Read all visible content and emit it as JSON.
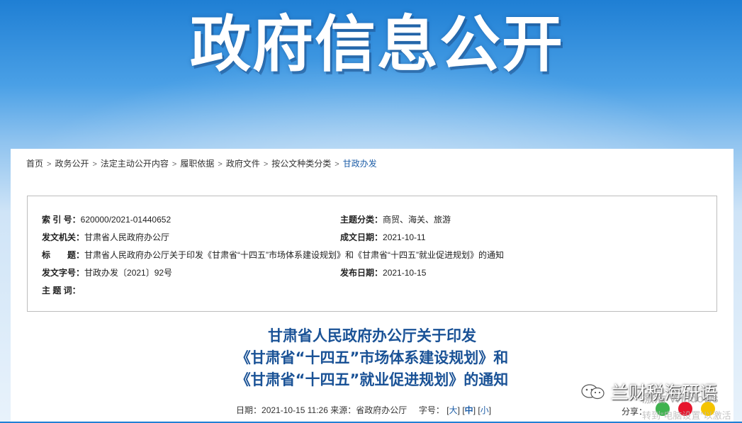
{
  "banner": {
    "title": "政府信息公开"
  },
  "breadcrumb": {
    "items": [
      "首页",
      "政务公开",
      "法定主动公开内容",
      "履职依据",
      "政府文件",
      "按公文种类分类"
    ],
    "current": "甘政办发",
    "sep": ">"
  },
  "meta": {
    "index_label": "索 引 号：",
    "index_value": "620000/2021-01440652",
    "category_label": "主题分类：",
    "category_value": "商贸、海关、旅游",
    "issuer_label": "发文机关：",
    "issuer_value": "甘肃省人民政府办公厅",
    "created_label": "成文日期：",
    "created_value": "2021-10-11",
    "title_label": "标　　题：",
    "title_value": "甘肃省人民政府办公厅关于印发《甘肃省“十四五”市场体系建设规划》和《甘肃省“十四五”就业促进规划》的通知",
    "docno_label": "发文字号：",
    "docno_value": "甘政办发〔2021〕92号",
    "published_label": "发布日期：",
    "published_value": "2021-10-15",
    "keywords_label": "主 题 词：",
    "keywords_value": ""
  },
  "doc": {
    "title_line1": "甘肃省人民政府办公厅关于印发",
    "title_line2": "《甘肃省“十四五”市场体系建设规划》和",
    "title_line3": "《甘肃省“十四五”就业促进规划》的通知",
    "date_label": "日期：",
    "date_value": "2021-10-15 11:26",
    "source_label": "来源：",
    "source_value": "省政府办公厅",
    "fontsize_label": "字号：",
    "size_large": "大",
    "size_medium": "中",
    "size_small": "小",
    "share_label": "分享："
  },
  "overlay": {
    "watermark": "兰财税海研语",
    "activation_line1": "激活 Windows",
    "activation_line2": "转到“电脑设置”以激活"
  },
  "colors": {
    "accent": "#1a5296",
    "link": "#1f5fa8",
    "banner_top": "#1f7fd4"
  }
}
